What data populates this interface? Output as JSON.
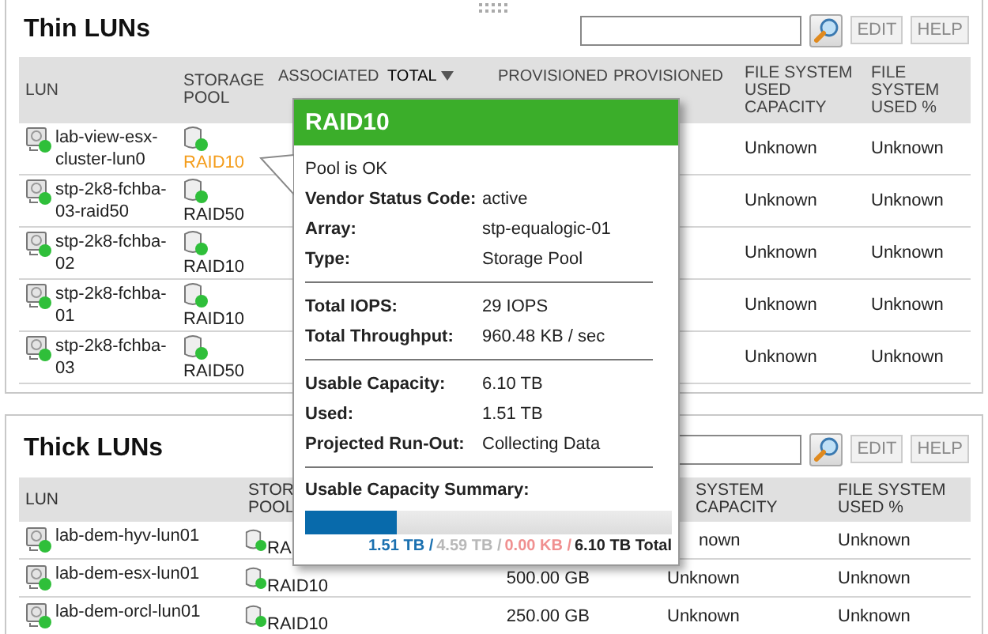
{
  "thin_luns": {
    "title": "Thin LUNs",
    "buttons": [
      "EDIT",
      "HELP"
    ],
    "columns": [
      {
        "lines": [
          "LUN"
        ],
        "sorted": false
      },
      {
        "lines": [
          "STORAGE",
          "POOL"
        ],
        "sorted": false
      },
      {
        "lines": [
          "ASSOCIATED"
        ],
        "sorted": false
      },
      {
        "lines": [
          "TOTAL"
        ],
        "sorted": true
      },
      {
        "lines": [
          "PROVISIONED"
        ],
        "sorted": false
      },
      {
        "lines": [
          "PROVISIONED"
        ],
        "sorted": false
      },
      {
        "lines": [
          "FILE SYSTEM",
          "USED",
          "CAPACITY"
        ],
        "sorted": false
      },
      {
        "lines": [
          "FILE",
          "SYSTEM",
          "USED %"
        ],
        "sorted": false
      }
    ],
    "rows": [
      {
        "lun": "lab-view-esx-cluster-lun0",
        "pool": "RAID10",
        "highlighted": true,
        "fs_used_capacity": "Unknown",
        "fs_used_pct": "Unknown"
      },
      {
        "lun": "stp-2k8-fchba-03-raid50",
        "pool": "RAID50",
        "highlighted": false,
        "fs_used_capacity": "Unknown",
        "fs_used_pct": "Unknown"
      },
      {
        "lun": "stp-2k8-fchba-02",
        "pool": "RAID10",
        "highlighted": false,
        "fs_used_capacity": "Unknown",
        "fs_used_pct": "Unknown"
      },
      {
        "lun": "stp-2k8-fchba-01",
        "pool": "RAID10",
        "highlighted": false,
        "fs_used_capacity": "Unknown",
        "fs_used_pct": "Unknown"
      },
      {
        "lun": "stp-2k8-fchba-03",
        "pool": "RAID50",
        "highlighted": false,
        "fs_used_capacity": "Unknown",
        "fs_used_pct": "Unknown"
      }
    ]
  },
  "thick_luns": {
    "title": "Thick LUNs",
    "buttons": [
      "EDIT",
      "HELP"
    ],
    "columns": [
      {
        "lines": [
          "LUN"
        ]
      },
      {
        "lines": [
          "STOR",
          "POOL"
        ]
      },
      {},
      {
        "lines": [
          "SYSTEM",
          "CAPACITY"
        ]
      },
      {
        "lines": [
          "FILE SYSTEM",
          "USED %"
        ]
      }
    ],
    "rows": [
      {
        "lun": "lab-dem-hyv-lun01",
        "pool": "RA",
        "fs_used_capacity": "nown",
        "fs_used_pct": "Unknown"
      },
      {
        "lun": "lab-dem-esx-lun01",
        "pool": "RAID10",
        "column_3": "500.00 GB",
        "fs_used_capacity": "Unknown",
        "fs_used_pct": "Unknown"
      },
      {
        "lun": "lab-dem-orcl-lun01",
        "pool": "RAID10",
        "column_3": "250.00 GB",
        "fs_used_capacity": "Unknown",
        "fs_used_pct": "Unknown"
      }
    ]
  },
  "pool_popup": {
    "title": "RAID10",
    "status": "Pool is OK",
    "groups": [
      [
        {
          "label": "Vendor Status Code:",
          "value": "active"
        },
        {
          "label": "Array:",
          "value": "stp-equalogic-01"
        },
        {
          "label": "Type:",
          "value": "Storage Pool"
        }
      ],
      [
        {
          "label": "Total IOPS:",
          "value": "29 IOPS"
        },
        {
          "label": "Total Throughput:",
          "value": "960.48 KB / sec"
        }
      ],
      [
        {
          "label": "Usable Capacity:",
          "value": "6.10 TB"
        },
        {
          "label": "Used:",
          "value": "1.51 TB"
        },
        {
          "label": "Projected Run-Out:",
          "value": "Collecting Data"
        }
      ]
    ],
    "summary": {
      "label": "Usable Capacity Summary:",
      "level": 0.25,
      "legend": [
        {
          "text": "1.51 TB /",
          "color": "#1a70b0"
        },
        {
          "text": "4.59 TB /",
          "color": "#b8b8b8"
        },
        {
          "text": "0.00 KB /",
          "color": "#f09090"
        },
        {
          "text": "6.10 TB Total",
          "color": "#222222"
        }
      ]
    }
  }
}
